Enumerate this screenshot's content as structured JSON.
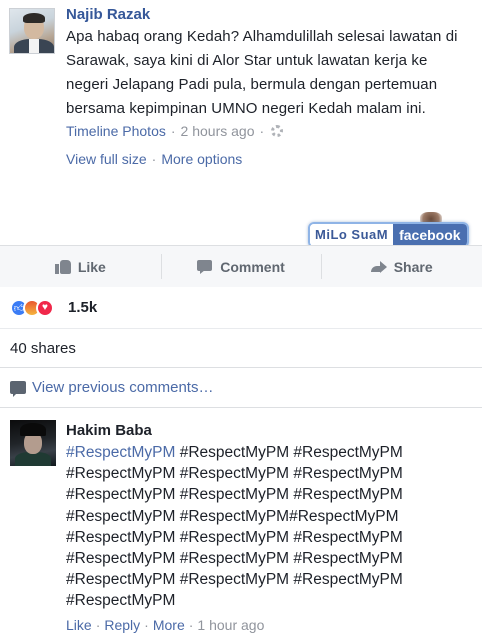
{
  "post": {
    "author": "Najib Razak",
    "text": "Apa habaq orang Kedah? Alhamdulillah selesai lawatan di Sarawak, saya kini di Alor Star untuk lawatan kerja ke negeri Jelapang Padi pula, bermula dengan pertemuan bersama kepimpinan UMNO negeri Kedah malam ini.",
    "album": "Timeline Photos",
    "sep": "·",
    "time": "2 hours ago",
    "privacy_icon": "gear-icon",
    "view_full": "View full size",
    "more_options": "More options"
  },
  "watermark": {
    "left": "MiLo SuaM",
    "right": "facebook"
  },
  "actions": {
    "like": "Like",
    "comment": "Comment",
    "share": "Share"
  },
  "reactions": {
    "types": [
      "like",
      "angry",
      "love"
    ],
    "count": "1.5k"
  },
  "shares": "40 shares",
  "view_previous": "View previous comments…",
  "comment": {
    "author": "Hakim Baba",
    "first_tag": "#RespectMyPM",
    "text": " #RespectMyPM #RespectMyPM\n#RespectMyPM #RespectMyPM #RespectMyPM\n#RespectMyPM #RespectMyPM #RespectMyPM\n#RespectMyPM #RespectMyPM#RespectMyPM\n#RespectMyPM #RespectMyPM #RespectMyPM\n#RespectMyPM #RespectMyPM #RespectMyPM\n#RespectMyPM #RespectMyPM #RespectMyPM\n#RespectMyPM",
    "like": "Like",
    "reply": "Reply",
    "more": "More",
    "sep": "·",
    "time": "1 hour ago"
  },
  "colors": {
    "link": "#4b6aa7",
    "author": "#365899",
    "meta": "#90949c",
    "like_reaction": "#3b7cf5",
    "love_reaction": "#f0284a"
  }
}
